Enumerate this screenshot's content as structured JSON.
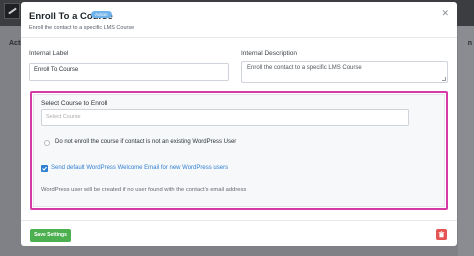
{
  "background": {
    "left_text": "Acti",
    "right_text": "n"
  },
  "modal": {
    "title": "Enroll To a Course",
    "badge": "Action",
    "subtitle": "Enroll the contact to a specific LMS Course",
    "close_icon": "close-icon"
  },
  "form": {
    "internal_label": {
      "label": "Internal Label",
      "value": "Enroll To Course"
    },
    "internal_description": {
      "label": "Internal Description",
      "value": "Enroll the contact to a specific LMS Course"
    },
    "course_select": {
      "label": "Select Course to Enroll",
      "placeholder": "Select Course"
    },
    "option_skip_non_user": {
      "label": "Do not enroll the course if contact is not an existing WordPress User",
      "checked": false
    },
    "option_welcome_email": {
      "label": "Send default WordPress Welcome Email for new WordPress users",
      "checked": true
    },
    "help_text": "WordPress user will be created if no user found with the contact's email address"
  },
  "footer": {
    "save_label": "Save Settings",
    "delete_icon": "trash-icon"
  },
  "colors": {
    "accent_blue": "#2f7fd2",
    "save_green": "#4caf50",
    "delete_red": "#e55353",
    "highlight_magenta": "#d63aa4"
  }
}
